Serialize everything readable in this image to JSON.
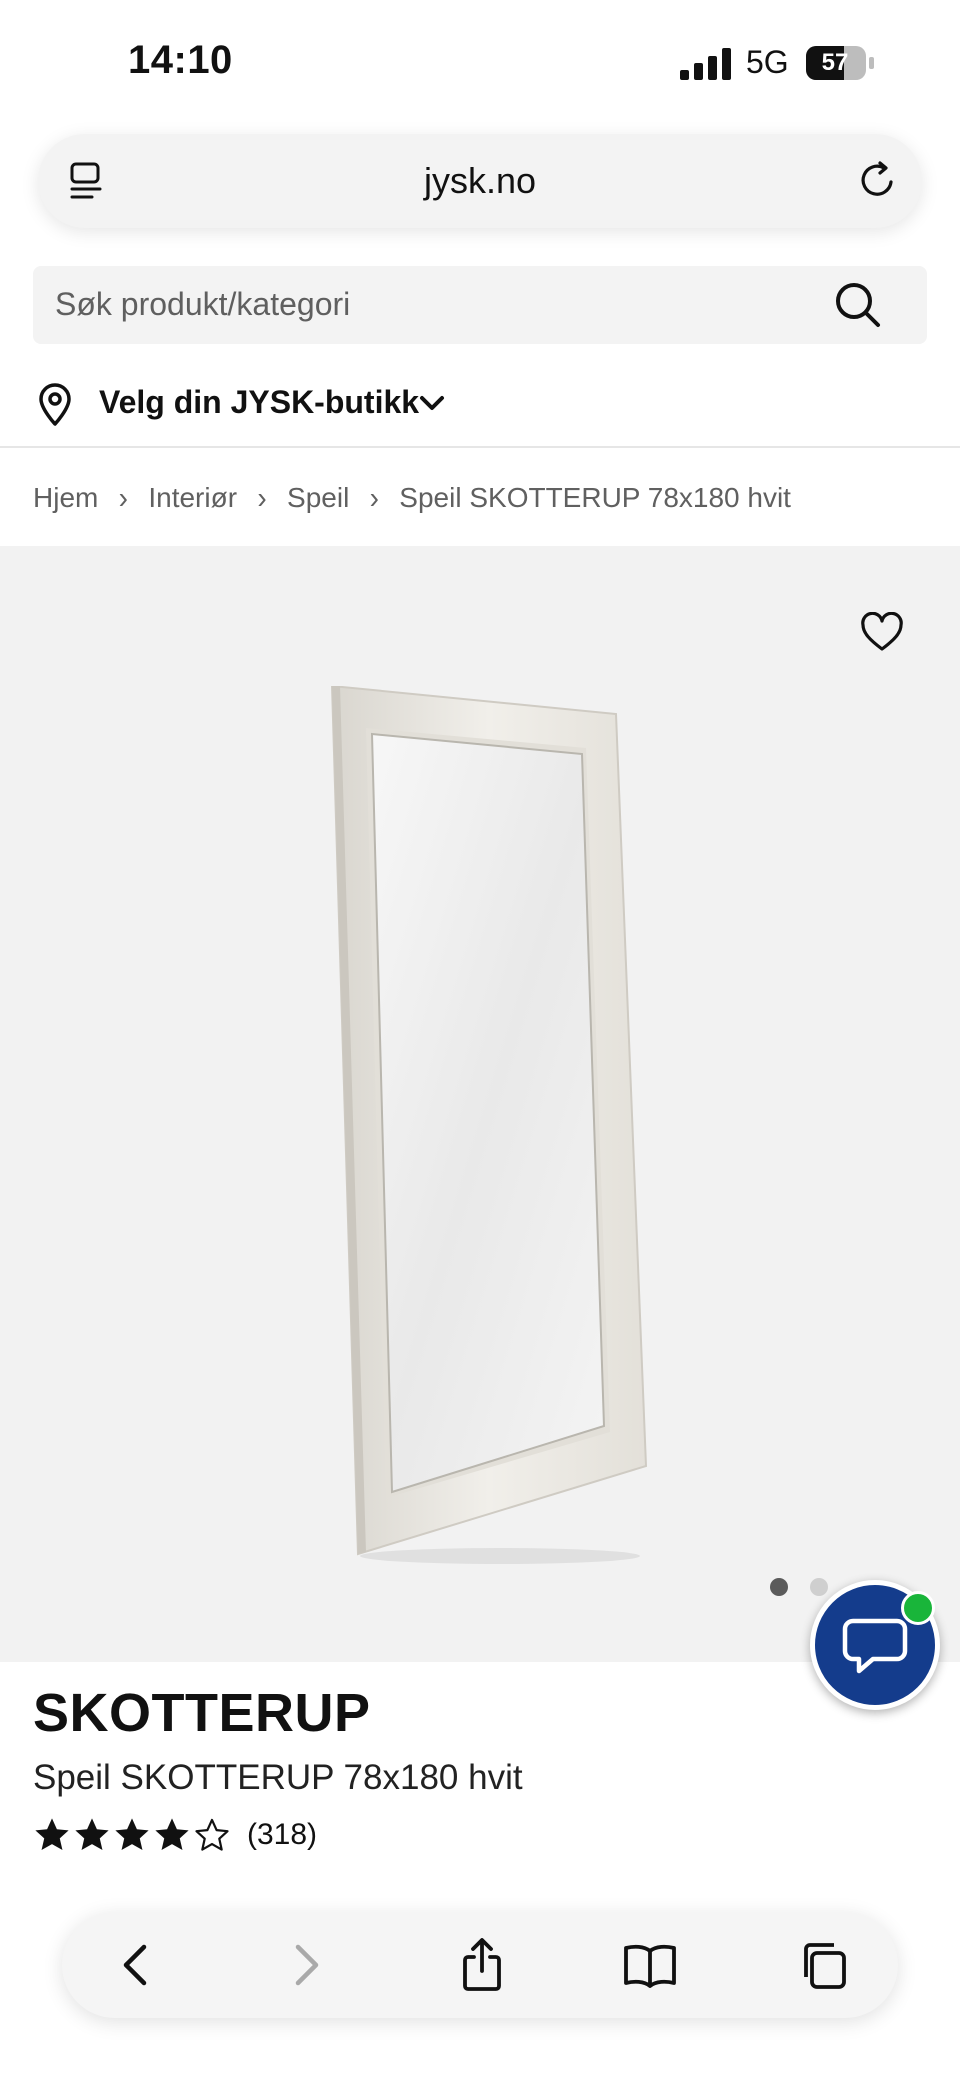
{
  "status_bar": {
    "time": "14:10",
    "network": "5G",
    "battery": "57"
  },
  "browser": {
    "url": "jysk.no",
    "icons": {
      "tabs_list": "tab-list-icon",
      "reload": "reload-icon"
    }
  },
  "search": {
    "placeholder": "Søk produkt/kategori",
    "icon": "search-icon"
  },
  "store_selector": {
    "label": "Velg din JYSK-butikk",
    "icons": [
      "location-pin-icon",
      "chevron-down-icon"
    ]
  },
  "breadcrumb": {
    "items": [
      "Hjem",
      "Interiør",
      "Speil",
      "Speil SKOTTERUP 78x180 hvit"
    ],
    "separator": "›"
  },
  "gallery": {
    "image_count": 2,
    "active_index": 1,
    "wishlist_icon": "heart-icon"
  },
  "product": {
    "brand": "SKOTTERUP",
    "title": "Speil SKOTTERUP 78x180 hvit",
    "rating": 4,
    "rating_max": 5,
    "review_count": "(318)"
  },
  "chat": {
    "icon": "chat-bubble-icon",
    "online_color": "#19b53a",
    "button_color": "#143c8c"
  },
  "toolbar": {
    "buttons": [
      "back",
      "forward",
      "share",
      "bookmarks",
      "tabs"
    ]
  }
}
